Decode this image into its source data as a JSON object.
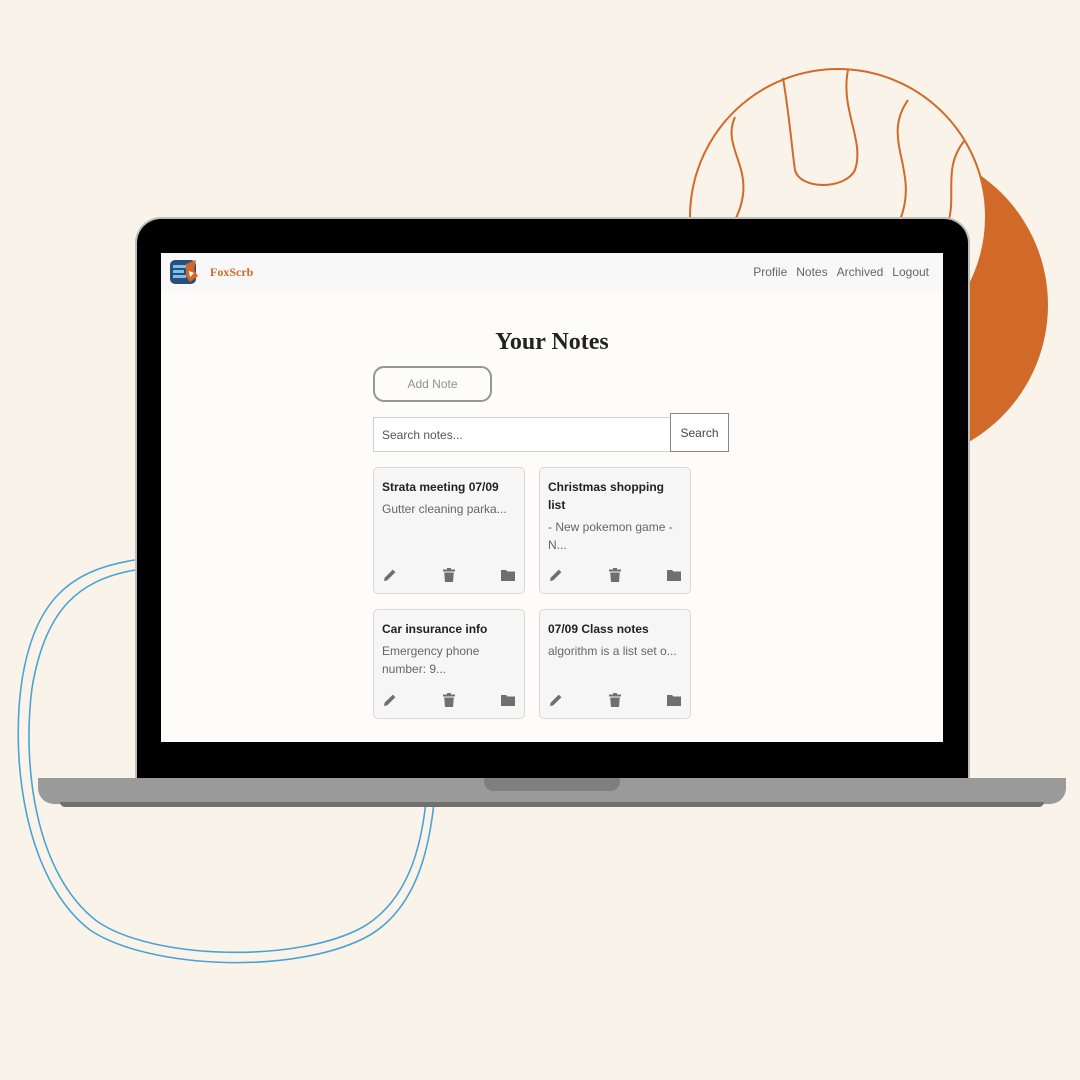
{
  "app": {
    "brand": "FoxScrb"
  },
  "nav": {
    "items": [
      {
        "label": "Profile"
      },
      {
        "label": "Notes"
      },
      {
        "label": "Archived"
      },
      {
        "label": "Logout"
      }
    ]
  },
  "page": {
    "title": "Your Notes",
    "add_button": "Add Note",
    "search_placeholder": "Search notes...",
    "search_button": "Search"
  },
  "notes": [
    {
      "title": "Strata meeting 07/09",
      "preview": "Gutter cleaning  parka..."
    },
    {
      "title": "Christmas shopping list",
      "preview": "- New pokemon game - N..."
    },
    {
      "title": "Car insurance info",
      "preview": "Emergency phone number: 9..."
    },
    {
      "title": "07/09 Class notes",
      "preview": "algorithm is a list set o..."
    }
  ],
  "colors": {
    "background": "#faf3ea",
    "accent_orange": "#d16a28",
    "line_blue": "#4aa3d3",
    "icon_gray": "#6f6f6f"
  },
  "icons": [
    "pencil-icon",
    "trash-icon",
    "folder-icon"
  ]
}
